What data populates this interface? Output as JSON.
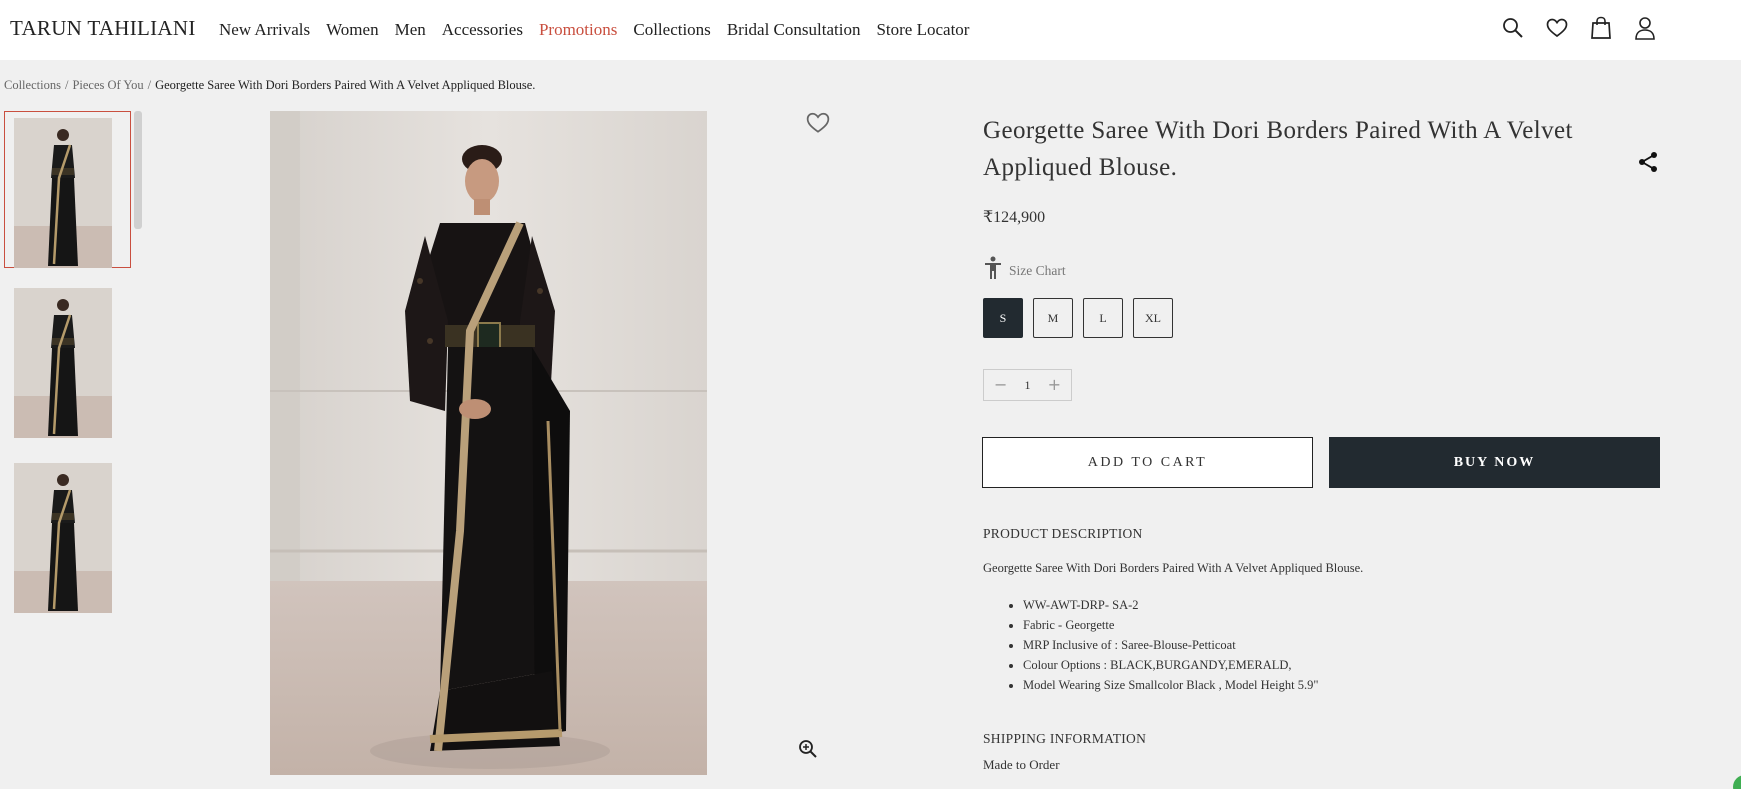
{
  "brand": {
    "logo_text": "TARUN TAHILIANI"
  },
  "nav": {
    "items": [
      {
        "label": "New Arrivals",
        "highlight": false
      },
      {
        "label": "Women",
        "highlight": false
      },
      {
        "label": "Men",
        "highlight": false
      },
      {
        "label": "Accessories",
        "highlight": false
      },
      {
        "label": "Promotions",
        "highlight": true
      },
      {
        "label": "Collections",
        "highlight": false
      },
      {
        "label": "Bridal Consultation",
        "highlight": false
      },
      {
        "label": "Store Locator",
        "highlight": false
      }
    ]
  },
  "header_icons": [
    "search-icon",
    "heart-icon",
    "shopping-bag-icon",
    "user-icon"
  ],
  "breadcrumb": {
    "items": [
      "Collections",
      "Pieces Of You"
    ],
    "current": "Georgette Saree With Dori Borders Paired With A Velvet Appliqued Blouse."
  },
  "gallery": {
    "thumbnails": [
      "thumbnail-1",
      "thumbnail-2",
      "thumbnail-3"
    ],
    "selected_index": 0
  },
  "product": {
    "title": "Georgette Saree With Dori Borders Paired With A Velvet Appliqued Blouse.",
    "price": "₹124,900",
    "size_chart_label": "Size Chart",
    "sizes": [
      {
        "label": "S",
        "selected": true
      },
      {
        "label": "M",
        "selected": false
      },
      {
        "label": "L",
        "selected": false
      },
      {
        "label": "XL",
        "selected": false
      }
    ],
    "quantity": "1",
    "add_to_cart_label": "ADD TO CART",
    "buy_now_label": "BUY NOW"
  },
  "description": {
    "heading": "PRODUCT DESCRIPTION",
    "text": "Georgette Saree With Dori Borders Paired With A Velvet Appliqued Blouse.",
    "bullets": [
      "WW-AWT-DRP- SA-2",
      "Fabric - Georgette",
      "MRP Inclusive of : Saree-Blouse-Petticoat",
      "Colour Options : BLACK,BURGANDY,EMERALD,",
      "Model Wearing Size Smallcolor Black , Model Height 5.9\""
    ]
  },
  "shipping": {
    "heading": "SHIPPING INFORMATION",
    "text": "Made to Order"
  },
  "colors": {
    "accent": "#c94f3f",
    "dark_button": "#222a30",
    "page_bg": "#f0f0f0"
  }
}
